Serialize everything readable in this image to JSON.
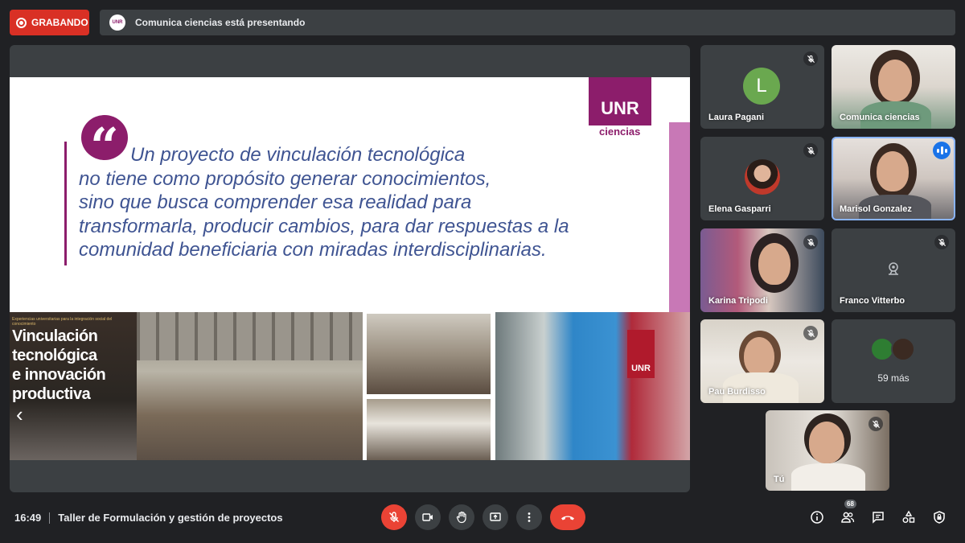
{
  "recording": {
    "label": "GRABANDO"
  },
  "presenting": {
    "logo_text": "UNR",
    "text": "Comunica ciencias está presentando"
  },
  "slide": {
    "logo": "UNR",
    "logo_sub": "ciencias",
    "quote_mark": "“",
    "quote_line1": "Un proyecto de vinculación tecnológica",
    "quote_line2": "no tiene como propósito generar conocimientos,",
    "quote_line3": "sino que busca comprender esa realidad para",
    "quote_line4": "transformarla, producir cambios, para dar respuestas a la",
    "quote_line5": "comunidad beneficiaria con miradas interdisciplinarias.",
    "photo1_small": "Experiencias universitarias para la integración social del conocimiento",
    "photo1_title_line1": "Vinculación",
    "photo1_title_line2": "tecnológica",
    "photo1_title_line3": "e innovación",
    "photo1_title_line4": "productiva",
    "photo1_arrow": "‹",
    "photo5_logo": "UNR"
  },
  "participants": [
    {
      "name": "Laura Pagani",
      "initial": "L",
      "muted": true
    },
    {
      "name": "Comunica ciencias",
      "muted": false
    },
    {
      "name": "Elena Gasparri",
      "muted": true
    },
    {
      "name": "Marisol Gonzalez",
      "speaking": true
    },
    {
      "name": "Karina Tripodi",
      "muted": true
    },
    {
      "name": "Franco Vitterbo",
      "muted": true
    },
    {
      "name": "Pau Burdisso",
      "muted": true
    },
    {
      "name": "Tú",
      "muted": true
    }
  ],
  "more": {
    "label": "59 más"
  },
  "bottom": {
    "time": "16:49",
    "meeting_title": "Taller de Formulación y gestión de proyectos",
    "people_count": "68"
  },
  "colors": {
    "accent": "#8c1d6b",
    "record_red": "#d93025",
    "quote_blue": "#3f5492",
    "speaking_blue": "#1a73e8"
  }
}
